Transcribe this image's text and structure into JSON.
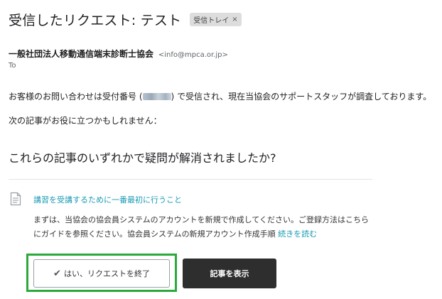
{
  "email": {
    "subject": "受信したリクエスト: テスト",
    "label": "受信トレイ",
    "label_close": "×",
    "sender_name": "一般社団法人移動通信端末診断士協会",
    "sender_email": "<info@mpca.or.jp>",
    "to": "To"
  },
  "body": {
    "line1_before": "お客様のお問い合わせは受付番号 (",
    "line1_after": ") で受信され、現在当協会のサポートスタッフが調査しております。",
    "line2": "次の記事がお役に立つかもしれません：",
    "heading": "これらの記事のいずれかで疑問が解消されましたか?",
    "article_title": "講習を受講するために一番最初に行うこと",
    "article_excerpt": "まずは、当協会の協会員システムのアカウントを新規で作成してください。ご登録方法はこちらにガイドを参照ください。協会員システムの新規アカウント作成手順 ",
    "read_more": "続きを読む"
  },
  "buttons": {
    "check_glyph": "✔",
    "yes_close": "はい、リクエストを終了",
    "view_article": "記事を表示"
  },
  "colors": {
    "link": "#1a9bb3",
    "highlight_box": "#2aaa3a",
    "dark_button": "#2e2e2e"
  },
  "icons": {
    "document": "document-icon",
    "check": "checkmark-icon"
  }
}
